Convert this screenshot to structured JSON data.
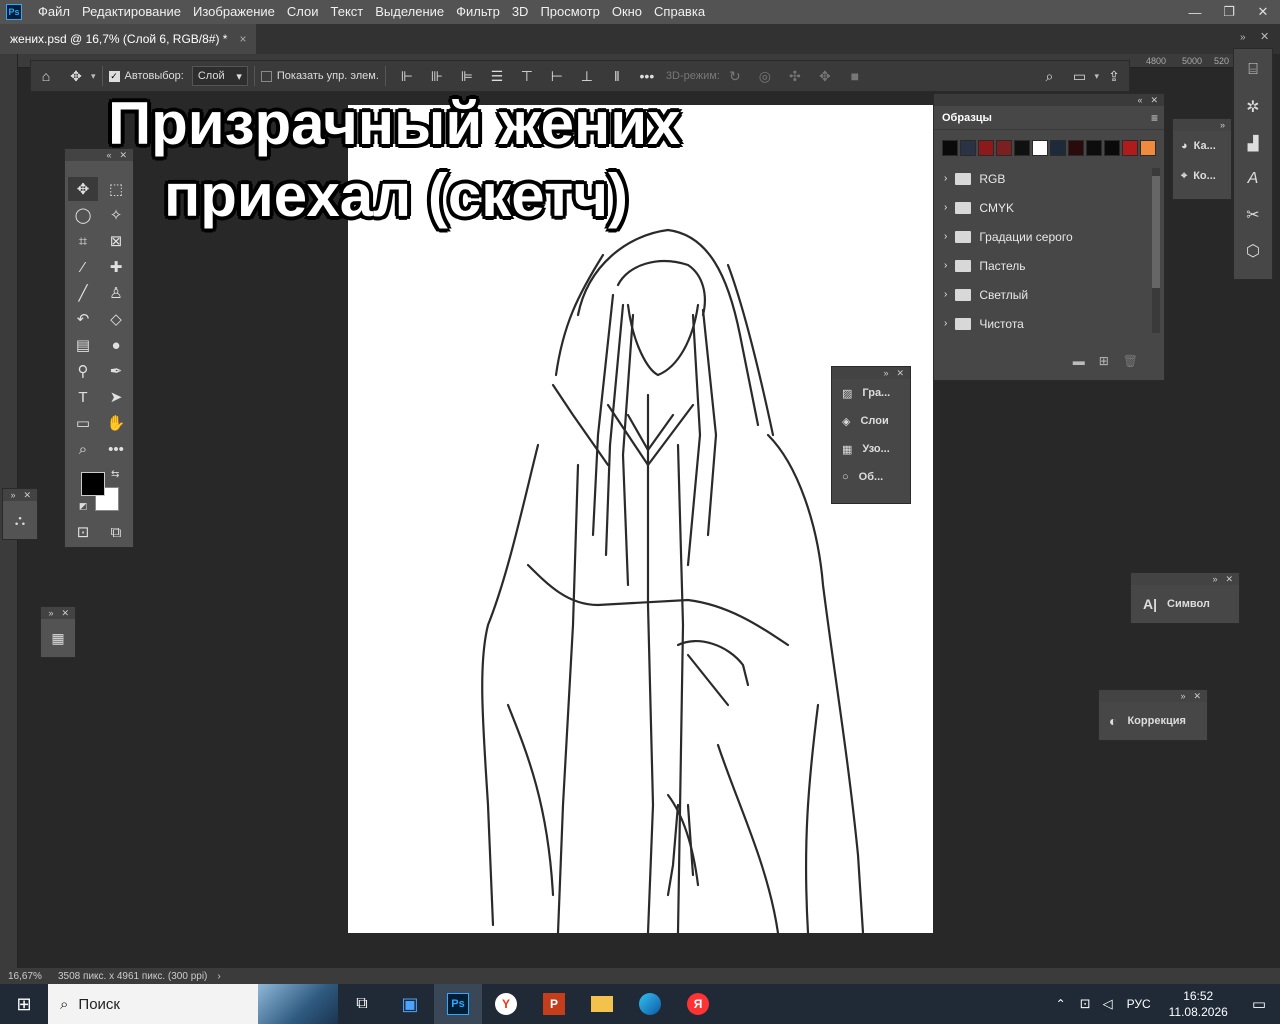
{
  "app": {
    "logo": "Ps",
    "menu": [
      "Файл",
      "Редактирование",
      "Изображение",
      "Слои",
      "Текст",
      "Выделение",
      "Фильтр",
      "3D",
      "Просмотр",
      "Окно",
      "Справка"
    ]
  },
  "document": {
    "tab_title": "жених.psd @ 16,7% (Слой 6, RGB/8#) *",
    "close": "×"
  },
  "ruler": {
    "ticks": [
      "4800",
      "5000",
      "520"
    ]
  },
  "options": {
    "autoselect_label": "Автовыбор:",
    "autoselect_value": "Слой",
    "show_transform": "Показать упр. элем.",
    "mode_3d": "3D-режим:"
  },
  "overlay": {
    "line1": "Призрачный жених",
    "line2": "приехал (скетч)"
  },
  "swatches": {
    "title": "Образцы",
    "colors": [
      "#0a0a0a",
      "#2a3345",
      "#8c1a1a",
      "#7a2020",
      "#101010",
      "#ffffff",
      "#1d2a3a",
      "#2a0a0a",
      "#0d0d0d",
      "#0a0a0a",
      "#b01c1c",
      "#f08a3c"
    ],
    "folders": [
      "RGB",
      "CMYK",
      "Градации серого",
      "Пастель",
      "Светлый",
      "Чистота"
    ]
  },
  "side_panel": {
    "items": [
      "Гра...",
      "Слои",
      "Узо...",
      "Об..."
    ]
  },
  "right_mini": {
    "items": [
      "Ка...",
      "Ко..."
    ]
  },
  "symbol_panel": {
    "label": "Символ"
  },
  "correction_panel": {
    "label": "Коррекция"
  },
  "status": {
    "zoom": "16,67%",
    "info": "3508 пикс. x 4961 пикс. (300 ppi)"
  },
  "taskbar": {
    "search_placeholder": "Поиск",
    "lang": "РУС",
    "time": "16:52",
    "date": "11.08.2026"
  }
}
